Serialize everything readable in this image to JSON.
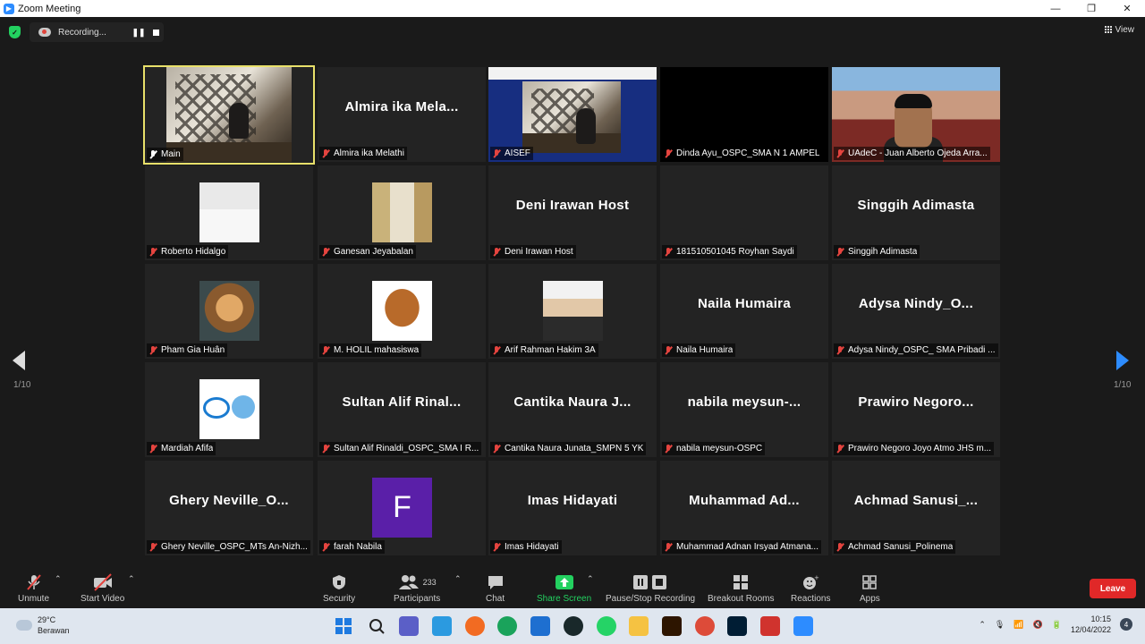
{
  "window": {
    "title": "Zoom Meeting",
    "minimize": "—",
    "maximize": "❐",
    "close": "✕"
  },
  "topbar": {
    "recording_label": "Recording...",
    "view_label": "View"
  },
  "pager": {
    "left_page": "1/10",
    "right_page": "1/10"
  },
  "tiles": [
    {
      "name": "Main",
      "mode": "video"
    },
    {
      "name": "Almira ika Melathi",
      "big": "Almira ika Mela..."
    },
    {
      "name": "AISEF",
      "mode": "aisef"
    },
    {
      "name": "Dinda Ayu_OSPC_SMA N 1 AMPEL",
      "mode": "black"
    },
    {
      "name": "UAdeC - Juan Alberto Ojeda Arra...",
      "mode": "uadec"
    },
    {
      "name": "Roberto Hidalgo",
      "thumb": "portrait-white"
    },
    {
      "name": "Ganesan Jeyabalan",
      "thumb": "portrait-suit"
    },
    {
      "name": "Deni Irawan Host",
      "big": "Deni Irawan Host"
    },
    {
      "name": "181510501045 Royhan Saydi",
      "big": ""
    },
    {
      "name": "Singgih Adimasta",
      "big": "Singgih Adimasta"
    },
    {
      "name": "Pham Gia Huân",
      "thumb": "sculpture"
    },
    {
      "name": "M. HOLIL mahasiswa",
      "thumb": "pangolin"
    },
    {
      "name": "Arif Rahman Hakim 3A",
      "thumb": "child"
    },
    {
      "name": "Naila Humaira",
      "big": "Naila Humaira"
    },
    {
      "name": "Adysa Nindy_OSPC_ SMA Pribadi ...",
      "big": "Adysa  Nindy_O..."
    },
    {
      "name": "Mardiah Afifa",
      "thumb": "logo"
    },
    {
      "name": "Sultan Alif Rinaldi_OSPC_SMA I R...",
      "big": "Sultan  Alif  Rinal..."
    },
    {
      "name": "Cantika Naura Junata_SMPN 5 YK",
      "big": "Cantika  Naura  J..."
    },
    {
      "name": "nabila meysun-OSPC",
      "big": "nabila  meysun-..."
    },
    {
      "name": "Prawiro Negoro Joyo Atmo JHS m...",
      "big": "Prawiro  Negoro..."
    },
    {
      "name": "Ghery Neville_OSPC_MTs An-Nizh...",
      "big": "Ghery  Neville_O..."
    },
    {
      "name": "farah Nabila",
      "thumb": "letter",
      "letter": "F"
    },
    {
      "name": "Imas Hidayati",
      "big": "Imas Hidayati"
    },
    {
      "name": "Muhammad Adnan Irsyad Atmana...",
      "big": "Muhammad  Ad..."
    },
    {
      "name": "Achmad Sanusi_Polinema",
      "big": "Achmad  Sanusi_..."
    }
  ],
  "toolbar": {
    "unmute": "Unmute",
    "start_video": "Start Video",
    "security": "Security",
    "participants": "Participants",
    "participants_count": "233",
    "chat": "Chat",
    "share_screen": "Share Screen",
    "recording": "Pause/Stop Recording",
    "breakout": "Breakout Rooms",
    "reactions": "Reactions",
    "apps": "Apps",
    "leave": "Leave"
  },
  "taskbar": {
    "temp": "29°C",
    "weather": "Berawan",
    "time": "10:15",
    "date": "12/04/2022",
    "notifications": "4"
  },
  "colors": {
    "accent": "#2d8cff",
    "leave": "#e02828",
    "share": "#23d160",
    "active_border": "#e8e06a"
  }
}
